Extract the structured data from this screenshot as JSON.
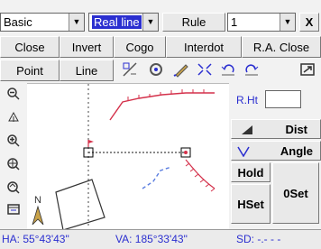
{
  "toolbar": {
    "mode_select": "Basic",
    "line_select": "Real line",
    "rule_label": "Rule",
    "number_select": "1",
    "close_x_label": "X"
  },
  "row2": {
    "close_label": "Close",
    "invert_label": "Invert",
    "cogo_label": "Cogo",
    "interdot_label": "Interdot",
    "ra_close_label": "R.A. Close"
  },
  "row3": {
    "point_label": "Point",
    "line_label": "Line",
    "icons": [
      "offset-icon",
      "settings-icon",
      "pencil-icon",
      "zoom-extent-icon",
      "undo-icon",
      "redo-icon",
      "export-icon"
    ]
  },
  "tools": [
    "zoom-out-icon",
    "pan-icon",
    "zoom-in-icon",
    "zoom-window-icon",
    "zoom-previous-icon",
    "layer-icon"
  ],
  "map": {
    "north_label": "N"
  },
  "right_panel": {
    "rht_label": "R.Ht",
    "rht_value": "",
    "dist_label": "Dist",
    "angle_label": "Angle",
    "hold_label": "Hold",
    "hset_label": "HSet",
    "oset_label": "0Set"
  },
  "status": {
    "ha": "HA:  55°43'43\"",
    "va": "VA:  185°33'43\"",
    "sd": "SD:    -.- - -"
  },
  "colors": {
    "accent_blue": "#2b2fd0",
    "line_red": "#d4314b"
  }
}
